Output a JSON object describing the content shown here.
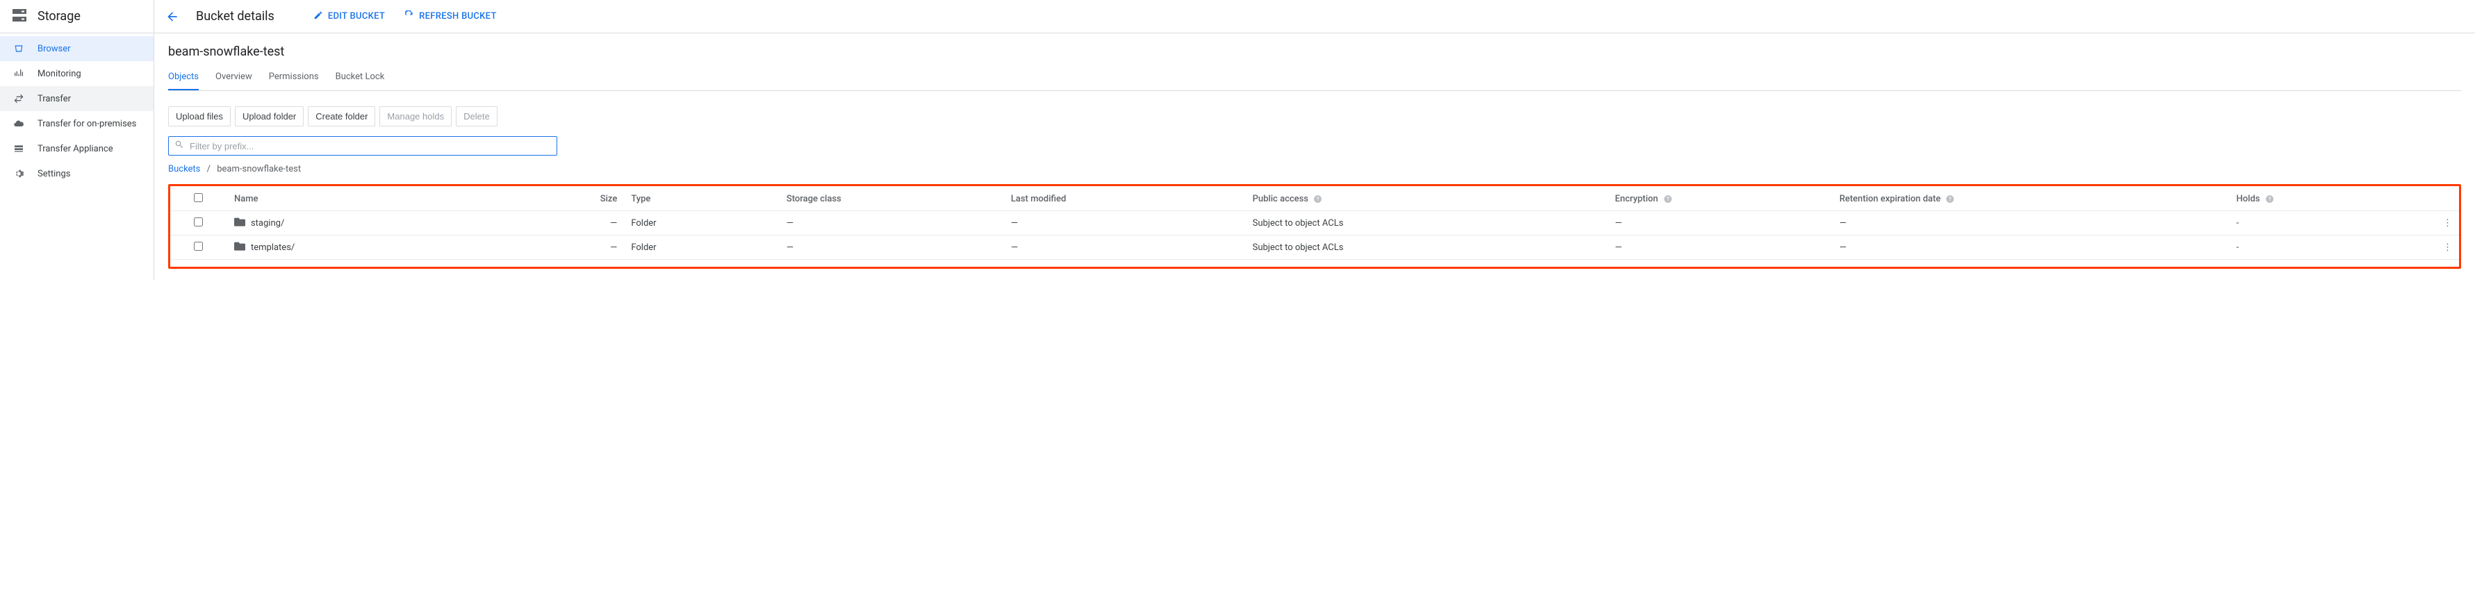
{
  "product": {
    "title": "Storage"
  },
  "sidebar": {
    "items": [
      {
        "label": "Browser"
      },
      {
        "label": "Monitoring"
      },
      {
        "label": "Transfer"
      },
      {
        "label": "Transfer for on-premises"
      },
      {
        "label": "Transfer Appliance"
      },
      {
        "label": "Settings"
      }
    ]
  },
  "header": {
    "title": "Bucket details",
    "edit": "EDIT BUCKET",
    "refresh": "REFRESH BUCKET"
  },
  "bucket": {
    "name": "beam-snowflake-test"
  },
  "tabs": [
    {
      "label": "Objects"
    },
    {
      "label": "Overview"
    },
    {
      "label": "Permissions"
    },
    {
      "label": "Bucket Lock"
    }
  ],
  "toolbar": {
    "upload_files": "Upload files",
    "upload_folder": "Upload folder",
    "create_folder": "Create folder",
    "manage_holds": "Manage holds",
    "delete": "Delete"
  },
  "filter": {
    "placeholder": "Filter by prefix...",
    "value": ""
  },
  "breadcrumb": {
    "root": "Buckets",
    "current": "beam-snowflake-test"
  },
  "columns": {
    "name": "Name",
    "size": "Size",
    "type": "Type",
    "storage_class": "Storage class",
    "last_modified": "Last modified",
    "public_access": "Public access",
    "encryption": "Encryption",
    "retention": "Retention expiration date",
    "holds": "Holds"
  },
  "rows": [
    {
      "name": "staging/",
      "size": "—",
      "type": "Folder",
      "storage_class": "—",
      "last_modified": "—",
      "public_access": "Subject to object ACLs",
      "encryption": "—",
      "retention": "—",
      "holds": "-"
    },
    {
      "name": "templates/",
      "size": "—",
      "type": "Folder",
      "storage_class": "—",
      "last_modified": "—",
      "public_access": "Subject to object ACLs",
      "encryption": "—",
      "retention": "—",
      "holds": "-"
    }
  ]
}
